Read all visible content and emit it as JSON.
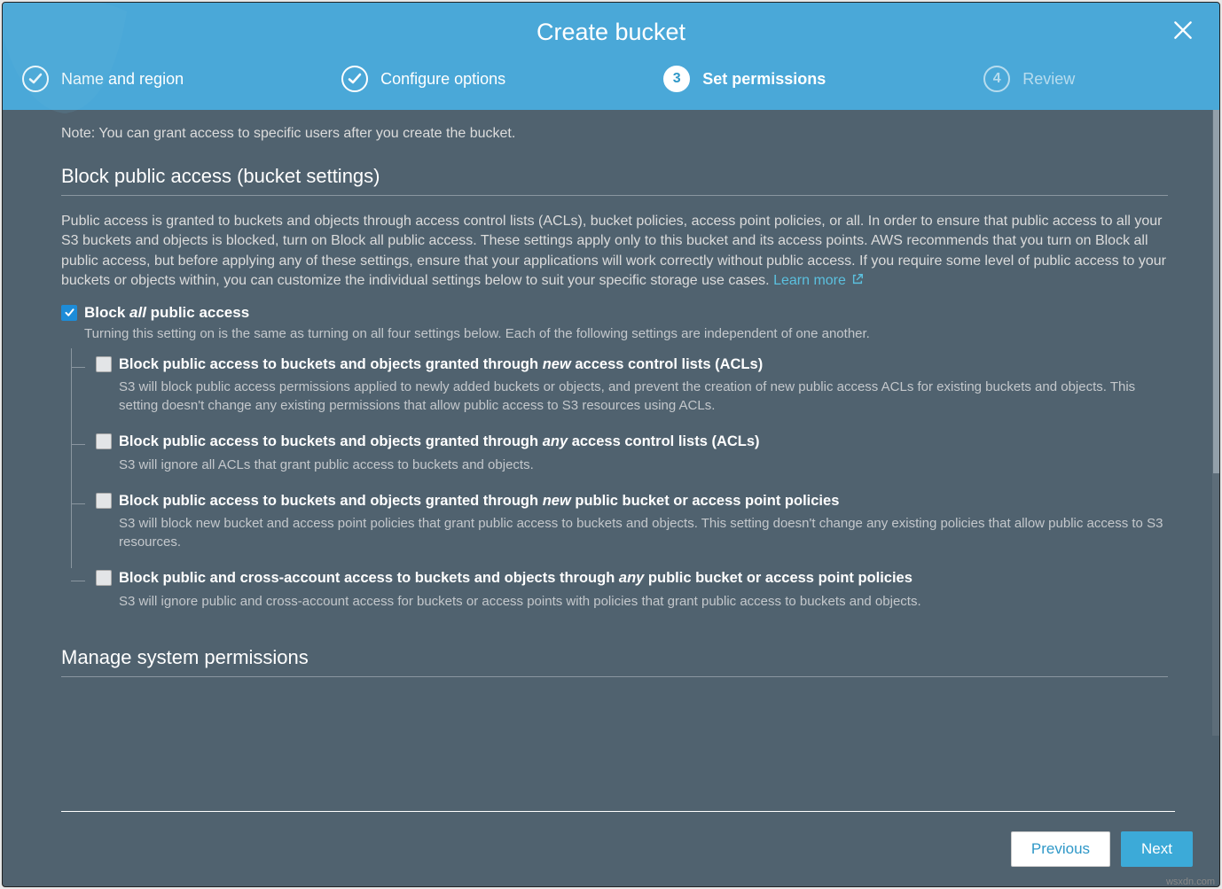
{
  "modal": {
    "title": "Create bucket"
  },
  "steps": [
    {
      "label": "Name and region",
      "done": true
    },
    {
      "label": "Configure options",
      "done": true
    },
    {
      "label": "Set permissions",
      "num": "3",
      "active": true
    },
    {
      "label": "Review",
      "num": "4"
    }
  ],
  "note": "Note: You can grant access to specific users after you create the bucket.",
  "block_section": {
    "title": "Block public access (bucket settings)",
    "desc": "Public access is granted to buckets and objects through access control lists (ACLs), bucket policies, access point policies, or all. In order to ensure that public access to all your S3 buckets and objects is blocked, turn on Block all public access. These settings apply only to this bucket and its access points. AWS recommends that you turn on Block all public access, but before applying any of these settings, ensure that your applications will work correctly without public access. If you require some level of public access to your buckets or objects within, you can customize the individual settings below to suit your specific storage use cases.",
    "learn_more": "Learn more",
    "main": {
      "label_pre": "Block ",
      "label_em": "all",
      "label_post": " public access",
      "sub": "Turning this setting on is the same as turning on all four settings below. Each of the following settings are independent of one another.",
      "checked": true
    },
    "children": [
      {
        "label_pre": "Block public access to buckets and objects granted through ",
        "label_em": "new",
        "label_post": " access control lists (ACLs)",
        "desc": "S3 will block public access permissions applied to newly added buckets or objects, and prevent the creation of new public access ACLs for existing buckets and objects. This setting doesn't change any existing permissions that allow public access to S3 resources using ACLs."
      },
      {
        "label_pre": "Block public access to buckets and objects granted through ",
        "label_em": "any",
        "label_post": " access control lists (ACLs)",
        "desc": "S3 will ignore all ACLs that grant public access to buckets and objects."
      },
      {
        "label_pre": "Block public access to buckets and objects granted through ",
        "label_em": "new",
        "label_post": " public bucket or access point policies",
        "desc": "S3 will block new bucket and access point policies that grant public access to buckets and objects. This setting doesn't change any existing policies that allow public access to S3 resources."
      },
      {
        "label_pre": "Block public and cross-account access to buckets and objects through ",
        "label_em": "any",
        "label_post": " public bucket or access point policies",
        "desc": "S3 will ignore public and cross-account access for buckets or access points with policies that grant public access to buckets and objects."
      }
    ]
  },
  "manage_section": {
    "title": "Manage system permissions"
  },
  "footer": {
    "previous": "Previous",
    "next": "Next"
  },
  "watermark": "wsxdn.com"
}
